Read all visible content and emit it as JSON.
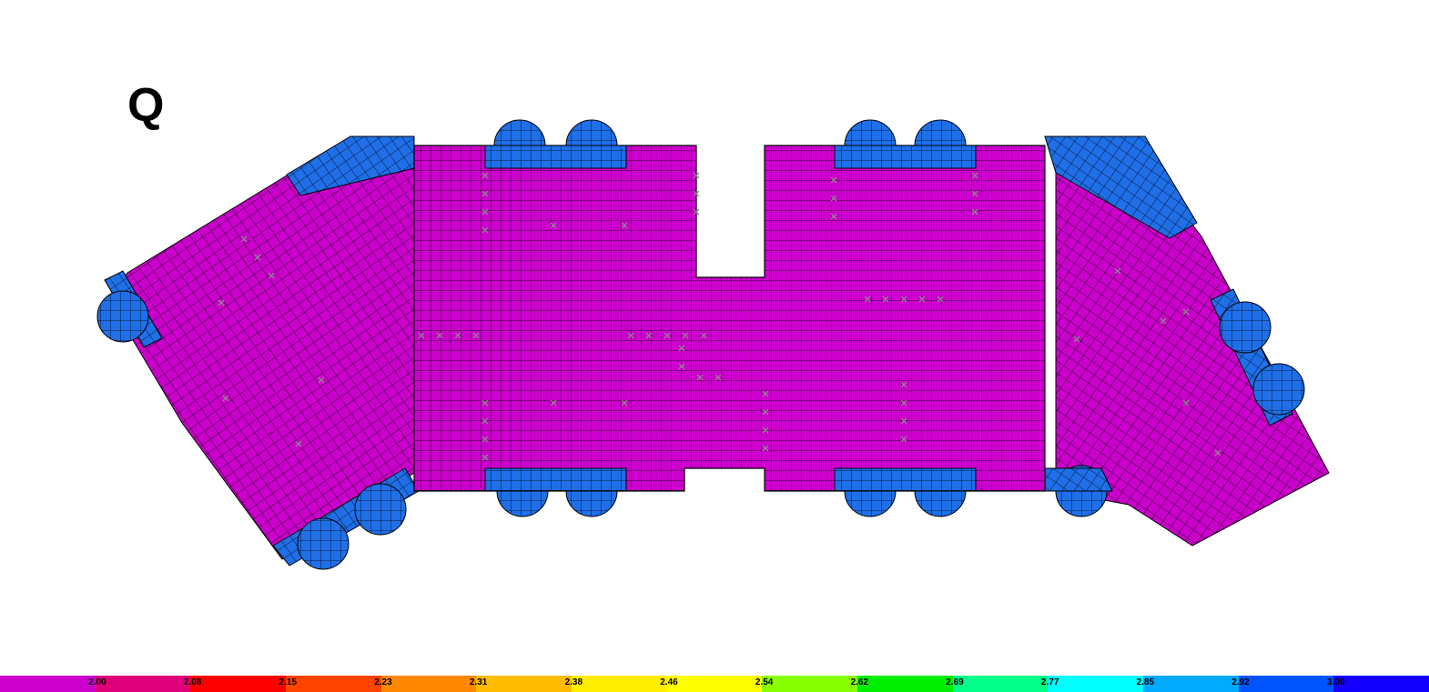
{
  "label": "Q",
  "colors": {
    "plate": "#cc00cc",
    "edge": "#1f6fe8",
    "mesh": "#000000",
    "support": "#8a8a8a",
    "background": "#ffffff"
  },
  "legend": {
    "values": [
      "2.00",
      "2.08",
      "2.15",
      "2.23",
      "2.31",
      "2.38",
      "2.46",
      "2.54",
      "2.62",
      "2.69",
      "2.77",
      "2.85",
      "2.92",
      "3.00"
    ],
    "colors": [
      "#cc00cc",
      "#e0007a",
      "#ff0000",
      "#ff4400",
      "#ff8800",
      "#ffbb00",
      "#ffee00",
      "#ffff00",
      "#88ff00",
      "#00ee00",
      "#00ff88",
      "#00ffff",
      "#00aaff",
      "#0055ff",
      "#1400ff"
    ]
  }
}
